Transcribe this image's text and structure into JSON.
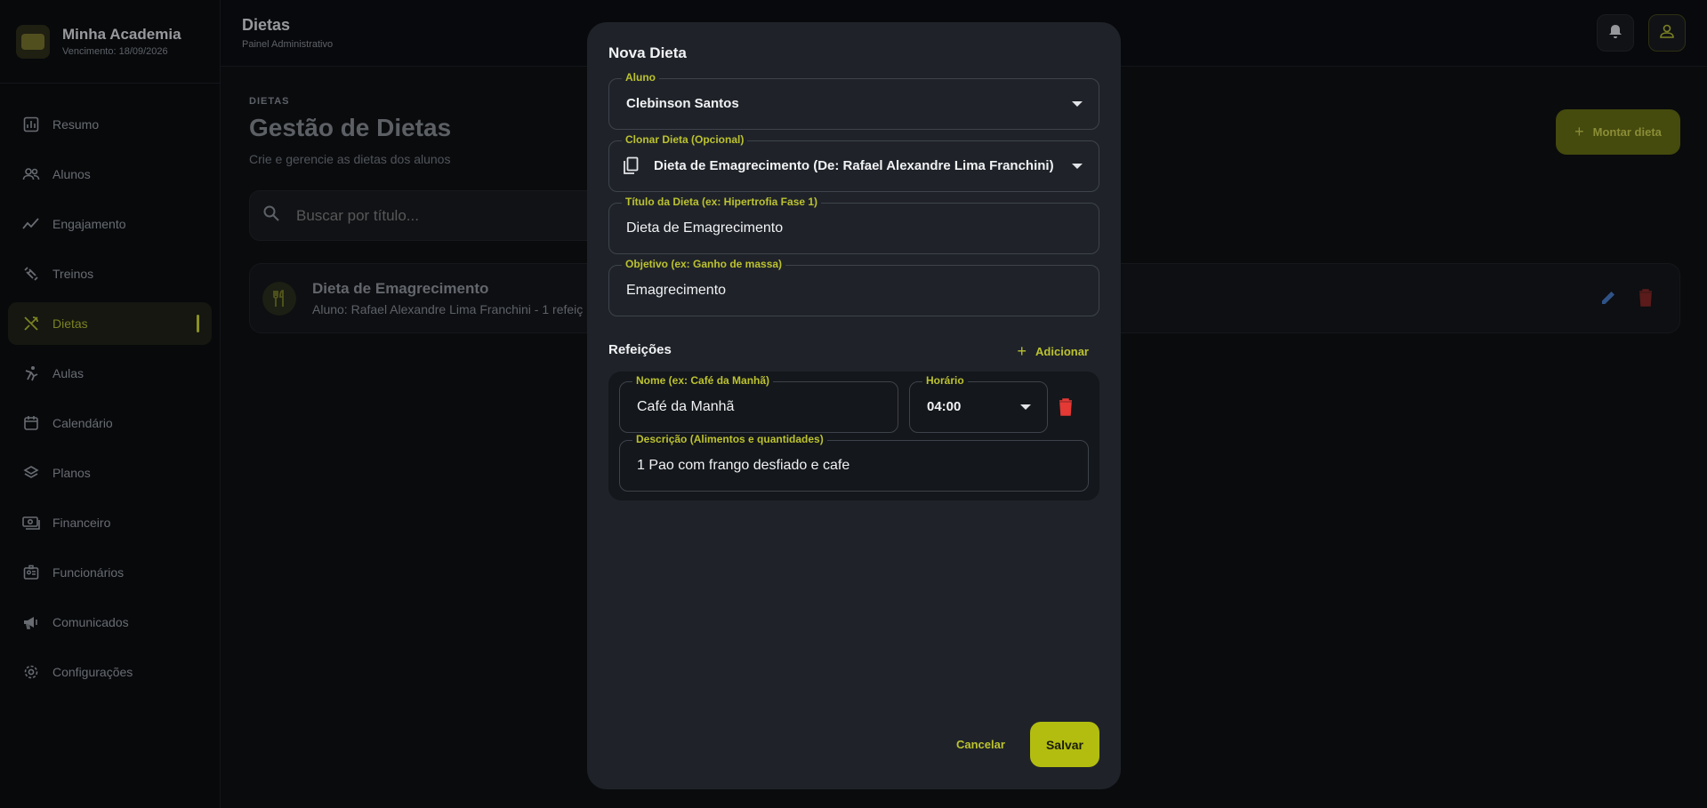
{
  "brand": {
    "title": "Minha Academia",
    "subtitle": "Vencimento: 18/09/2026"
  },
  "sidebar": {
    "items": [
      {
        "label": "Resumo",
        "icon": "chart-bar-icon"
      },
      {
        "label": "Alunos",
        "icon": "users-icon"
      },
      {
        "label": "Engajamento",
        "icon": "trending-icon"
      },
      {
        "label": "Treinos",
        "icon": "dumbbell-icon"
      },
      {
        "label": "Dietas",
        "icon": "utensils-icon",
        "active": true
      },
      {
        "label": "Aulas",
        "icon": "martial-arts-icon"
      },
      {
        "label": "Calendário",
        "icon": "calendar-icon"
      },
      {
        "label": "Planos",
        "icon": "layers-icon"
      },
      {
        "label": "Financeiro",
        "icon": "money-icon"
      },
      {
        "label": "Funcionários",
        "icon": "badge-icon"
      },
      {
        "label": "Comunicados",
        "icon": "megaphone-icon"
      },
      {
        "label": "Configurações",
        "icon": "gear-icon"
      }
    ]
  },
  "header": {
    "title": "Dietas",
    "subtitle": "Painel Administrativo"
  },
  "main": {
    "breadcrumb": "DIETAS",
    "title": "Gestão de Dietas",
    "subtitle": "Crie e gerencie as dietas dos alunos",
    "add_button": "Montar dieta",
    "search_placeholder": "Buscar por título...",
    "diet_card": {
      "title": "Dieta de Emagrecimento",
      "subtitle": "Aluno: Rafael Alexandre Lima Franchini - 1 refeiç"
    }
  },
  "modal": {
    "title": "Nova Dieta",
    "aluno": {
      "label": "Aluno",
      "value": "Clebinson Santos"
    },
    "clonar": {
      "label": "Clonar Dieta (Opcional)",
      "value": "Dieta de Emagrecimento (De: Rafael Alexandre Lima Franchini)"
    },
    "titulo": {
      "label": "Título da Dieta (ex: Hipertrofia Fase 1)",
      "value": "Dieta de Emagrecimento"
    },
    "objetivo": {
      "label": "Objetivo (ex: Ganho de massa)",
      "value": "Emagrecimento"
    },
    "refeicoes_title": "Refeições",
    "add_meal": "Adicionar",
    "meal": {
      "nome_label": "Nome (ex: Café da Manhã)",
      "nome_value": "Café da Manhã",
      "horario_label": "Horário",
      "horario_value": "04:00",
      "descricao_label": "Descrição (Alimentos e quantidades)",
      "descricao_value": "1 Pao com frango desfiado e cafe"
    },
    "cancel": "Cancelar",
    "save": "Salvar"
  },
  "colors": {
    "accent": "#b2bd10",
    "label": "#bcc22f",
    "modal_bg": "#1f2329",
    "delete": "#e53935",
    "edit": "#3f6fb5"
  }
}
